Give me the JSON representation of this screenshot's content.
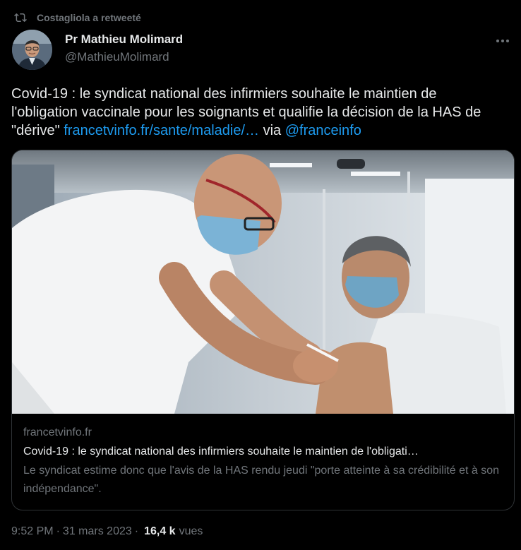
{
  "retweet": {
    "label": "Costagliola a retweeté",
    "icon": "retweet-icon"
  },
  "author": {
    "name": "Pr Mathieu Molimard",
    "handle": "@MathieuMolimard",
    "avatar_icon": "avatar"
  },
  "more_icon": "more-icon",
  "tweet": {
    "text_main": "Covid-19 : le syndicat national des infirmiers souhaite le maintien de l'obligation vaccinale pour les soignants et qualifie la décision de la HAS de \"dérive\" ",
    "link_text": "francetvinfo.fr/sante/maladie/…",
    "via": " via ",
    "mention": "@franceinfo"
  },
  "card": {
    "domain": "francetvinfo.fr",
    "title": "Covid-19 : le syndicat national des infirmiers souhaite le maintien de l'obligati…",
    "description": "Le syndicat estime donc que l'avis de la HAS rendu jeudi \"porte atteinte à sa crédibilité et à son indépendance\"."
  },
  "footer": {
    "time": "9:52 PM",
    "separator": "·",
    "date": "31 mars 2023",
    "views_count": "16,4 k",
    "views_label": "vues"
  },
  "colors": {
    "accent": "#1d9bf0",
    "text": "#e7e9ea",
    "muted": "#71767b",
    "background": "#000000"
  }
}
